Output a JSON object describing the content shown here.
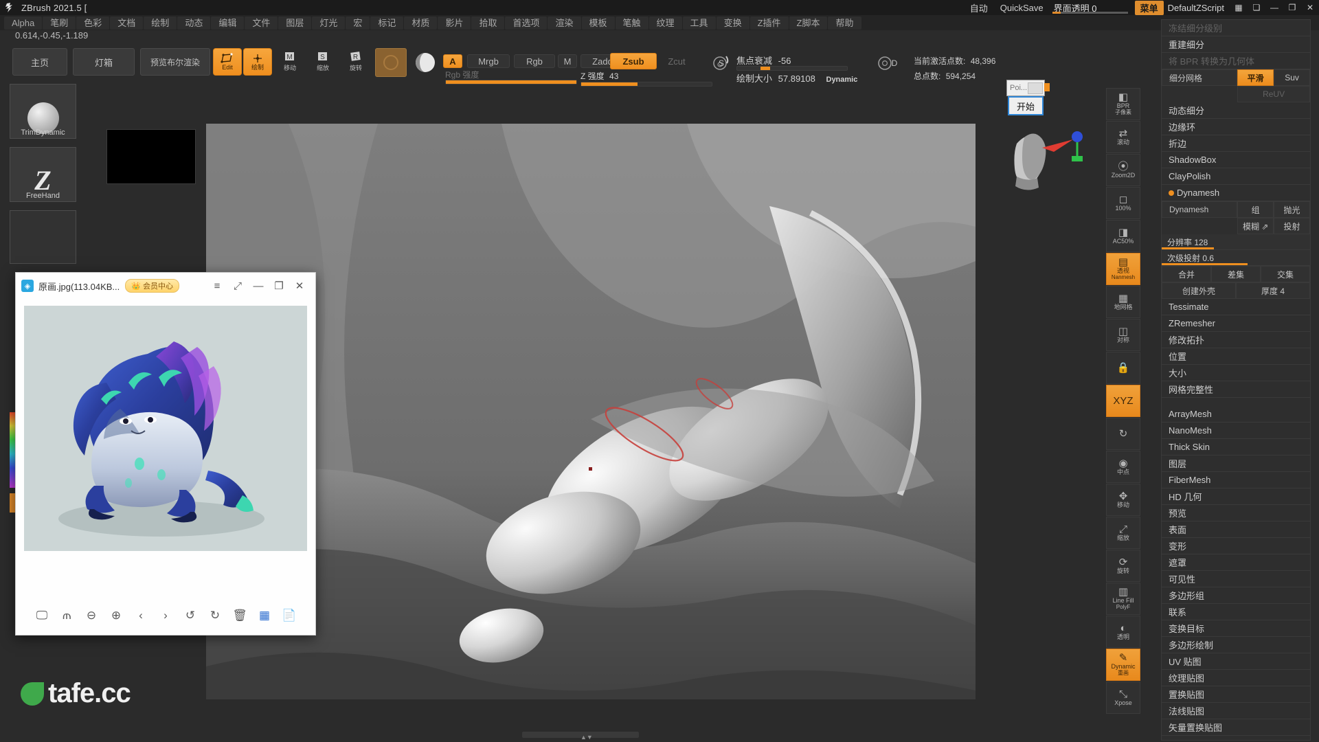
{
  "titlebar": {
    "app_title": "ZBrush 2021.5 [",
    "auto_label": "自动",
    "quicksave_label": "QuickSave",
    "transparency_label": "界面透明 0",
    "menu_button": "菜单",
    "zscript_label": "DefaultZScript",
    "window_buttons": [
      "—",
      "❐",
      "✕"
    ]
  },
  "menubar": {
    "items": [
      "Alpha",
      "笔刷",
      "色彩",
      "文档",
      "绘制",
      "动态",
      "编辑",
      "文件",
      "图层",
      "灯光",
      "宏",
      "标记",
      "材质",
      "影片",
      "拾取",
      "首选项",
      "渲染",
      "模板",
      "笔触",
      "纹理",
      "工具",
      "变换",
      "Z插件",
      "Z脚本",
      "帮助"
    ]
  },
  "coords": "0.614,-0.45,-1.189",
  "toolbar": {
    "home_label": "主页",
    "lightbox_label": "灯箱",
    "boolean_preview_label": "预览布尔渲染",
    "edit_label": "Edit",
    "edit_cap": "Edit",
    "draw_label": "绘制",
    "move_label": "移动",
    "scale_label": "缩放",
    "rotate_label": "旋转",
    "mrgb_group": {
      "alpha": "A",
      "mrgb": "Mrgb",
      "rgb": "Rgb",
      "m": "M",
      "rgb_intensity_label": "Rgb 强度",
      "rgb_intensity_value": "100"
    },
    "z_group": {
      "zadd": "Zadd",
      "zsub": "Zsub",
      "zcut": "Zcut",
      "z_intensity_label": "Z 强度",
      "z_intensity_value": "43"
    },
    "focal_shift_label": "焦点衰减",
    "focal_shift_value": "-56",
    "draw_size_label": "绘制大小",
    "draw_size_value": "57.89108",
    "dynamic_label": "Dynamic",
    "s_badge": "S",
    "d_badge": "D",
    "active_points_label": "当前激活点数:",
    "active_points_value": "48,396",
    "total_points_label": "总点数:",
    "total_points_value": "594,254"
  },
  "left": {
    "brush_label": "TrimDynamic",
    "stroke_label": "FreeHand"
  },
  "shelf": {
    "items": [
      {
        "icon": "◧",
        "label": "BPR",
        "sub": "子像素",
        "active": false
      },
      {
        "icon": "⇄",
        "label": "滚动",
        "sub": "",
        "active": false
      },
      {
        "icon": "⦿",
        "label": "Zoom2D",
        "sub": "",
        "active": false
      },
      {
        "icon": "◻",
        "label": "100%",
        "sub": "",
        "active": false
      },
      {
        "icon": "◨",
        "label": "AC50%",
        "sub": "",
        "active": false
      },
      {
        "icon": "▤",
        "label": "透视",
        "sub": "Nanmesh",
        "active": true
      },
      {
        "icon": "▦",
        "label": "地网格",
        "sub": "",
        "active": false
      },
      {
        "icon": "◫",
        "label": "对称",
        "sub": "",
        "active": false
      },
      {
        "icon": "🔒",
        "label": "",
        "sub": "",
        "active": false
      },
      {
        "icon": "XYZ",
        "label": "",
        "sub": "",
        "active": true
      },
      {
        "icon": "↻",
        "label": "",
        "sub": "",
        "active": false
      },
      {
        "icon": "◉",
        "label": "中点",
        "sub": "",
        "active": false
      },
      {
        "icon": "✥",
        "label": "移动",
        "sub": "",
        "active": false
      },
      {
        "icon": "⤢",
        "label": "缩放",
        "sub": "",
        "active": false
      },
      {
        "icon": "⟳",
        "label": "旋转",
        "sub": "",
        "active": false
      },
      {
        "icon": "▥",
        "label": "Line Fill",
        "sub": "PolyF",
        "active": false
      },
      {
        "icon": "◐",
        "label": "透明",
        "sub": "",
        "active": false
      },
      {
        "icon": "✎",
        "label": "Dynamic",
        "sub": "重画",
        "active": true
      },
      {
        "icon": "⤡",
        "label": "Xpose",
        "sub": "",
        "active": false
      }
    ]
  },
  "right_panel": {
    "rows": [
      {
        "label": "冻结细分级别",
        "type": "row",
        "state": "disabled"
      },
      {
        "label": "重建细分",
        "type": "row",
        "state": "normal"
      },
      {
        "label": "将 BPR 转换为几何体",
        "type": "row",
        "state": "disabled"
      },
      {
        "label": "细分网格",
        "type": "split",
        "cells": [
          {
            "label": "平滑",
            "state": "on"
          },
          {
            "label": "Suv",
            "state": "normal"
          },
          {
            "label": "ReUV",
            "state": "disabled"
          }
        ]
      },
      {
        "label": "动态细分",
        "type": "row",
        "state": "normal"
      },
      {
        "label": "边缘环",
        "type": "row",
        "state": "normal"
      },
      {
        "label": "折边",
        "type": "row",
        "state": "normal"
      },
      {
        "label": "ShadowBox",
        "type": "row",
        "state": "normal"
      },
      {
        "label": "ClayPolish",
        "type": "row",
        "state": "normal"
      },
      {
        "label": "Dynamesh",
        "type": "row",
        "state": "dot"
      },
      {
        "label": "Dynamesh",
        "type": "split",
        "cells": [
          {
            "label": "组",
            "state": "normal"
          },
          {
            "label": "抛光",
            "state": "normal"
          },
          {
            "label": "模糊 ⇗",
            "state": "normal"
          },
          {
            "label": "投射",
            "state": "normal"
          }
        ]
      }
    ],
    "sliders": [
      {
        "label": "分辨率 128",
        "fill": 35
      },
      {
        "label": "次级投射 0.6",
        "fill": 58
      }
    ],
    "merge_row": [
      {
        "label": "合并",
        "state": "normal"
      },
      {
        "label": "差集",
        "state": "normal"
      },
      {
        "label": "交集",
        "state": "normal"
      }
    ],
    "shell_row": [
      {
        "label": "创建外壳",
        "state": "normal"
      },
      {
        "label": "厚度 4",
        "state": "normal"
      }
    ],
    "list": [
      "Tessimate",
      "ZRemesher",
      "修改拓扑",
      "位置",
      "大小",
      "网格完整性"
    ],
    "list2": [
      "ArrayMesh",
      "NanoMesh",
      "Thick Skin",
      "图层",
      "FiberMesh",
      "HD 几何",
      "预览",
      "表面",
      "变形",
      "遮罩",
      "可见性",
      "多边形组",
      "联系",
      "变换目标",
      "多边形绘制",
      "UV 贴图",
      "纹理贴图",
      "置换贴图",
      "法线贴图",
      "矢量置换贴图"
    ]
  },
  "poi_dialog": {
    "title": "Poi...",
    "start_button": "开始"
  },
  "viewer": {
    "filename": "原画.jpg(113.04KB...",
    "vip_label": "会员中心",
    "titlebar_icons": [
      "≡",
      "⤢",
      "—",
      "❐",
      "✕"
    ],
    "toolbar_icons": [
      "🖵",
      "⫙",
      "⊖",
      "⊕",
      "‹",
      "›",
      "↺",
      "↻",
      "🗑",
      "▦",
      "📄"
    ]
  },
  "watermark": "tafe.cc",
  "colors": {
    "accent": "#ef8f1f",
    "panel_bg": "#2e2e2e",
    "app_bg": "#2b2b2b",
    "canvas_bg": "#6f6f6f",
    "highlight_blue": "#2f87d8"
  }
}
